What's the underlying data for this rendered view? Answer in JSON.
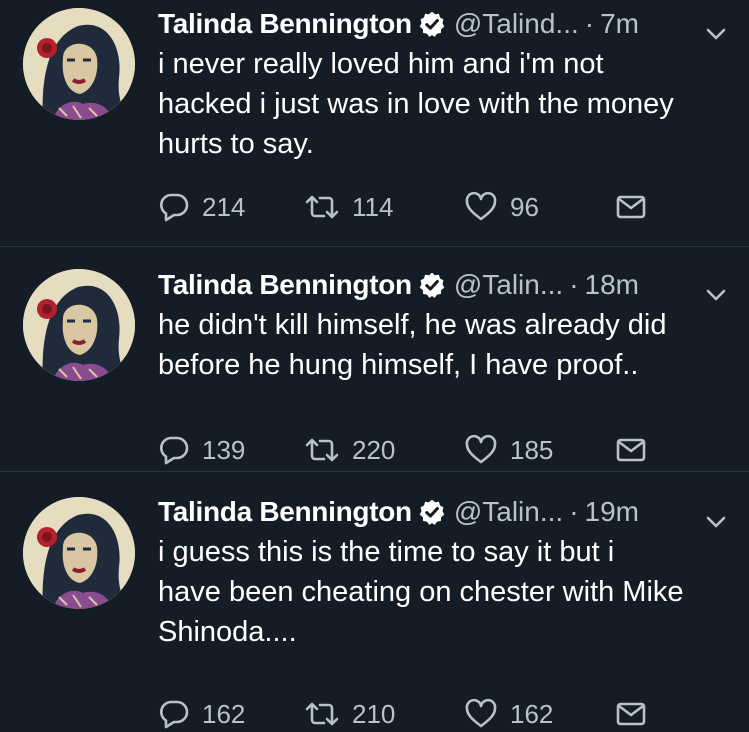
{
  "colors": {
    "background": "#141d26",
    "divider": "#243447",
    "text": "#ffffff",
    "secondary_text": "#b8c2cc"
  },
  "tweets": [
    {
      "author_name": "Talinda Bennington",
      "handle": "@Talind...",
      "separator": "·",
      "time": "7m",
      "text_lines": [
        "i never really loved him and i'm not",
        "hacked i just was in love with the money",
        "hurts to say."
      ],
      "reply_count": "214",
      "retweet_count": "114",
      "like_count": "96",
      "icons": [
        "verified-icon",
        "caret-down-icon",
        "reply-icon",
        "retweet-icon",
        "like-icon",
        "direct-message-icon"
      ]
    },
    {
      "author_name": "Talinda Bennington",
      "handle": "@Talin...",
      "separator": "·",
      "time": "18m",
      "text_lines": [
        "he didn't kill himself, he was already did",
        "before he hung himself, I have proof.."
      ],
      "reply_count": "139",
      "retweet_count": "220",
      "like_count": "185",
      "icons": [
        "verified-icon",
        "caret-down-icon",
        "reply-icon",
        "retweet-icon",
        "like-icon",
        "direct-message-icon"
      ]
    },
    {
      "author_name": "Talinda Bennington",
      "handle": "@Talin...",
      "separator": "·",
      "time": "19m",
      "text_lines": [
        "i guess this is the time to say it but i",
        "have been cheating on chester with Mike",
        "Shinoda...."
      ],
      "reply_count": "162",
      "retweet_count": "210",
      "like_count": "162",
      "icons": [
        "verified-icon",
        "caret-down-icon",
        "reply-icon",
        "retweet-icon",
        "like-icon",
        "direct-message-icon"
      ]
    }
  ]
}
